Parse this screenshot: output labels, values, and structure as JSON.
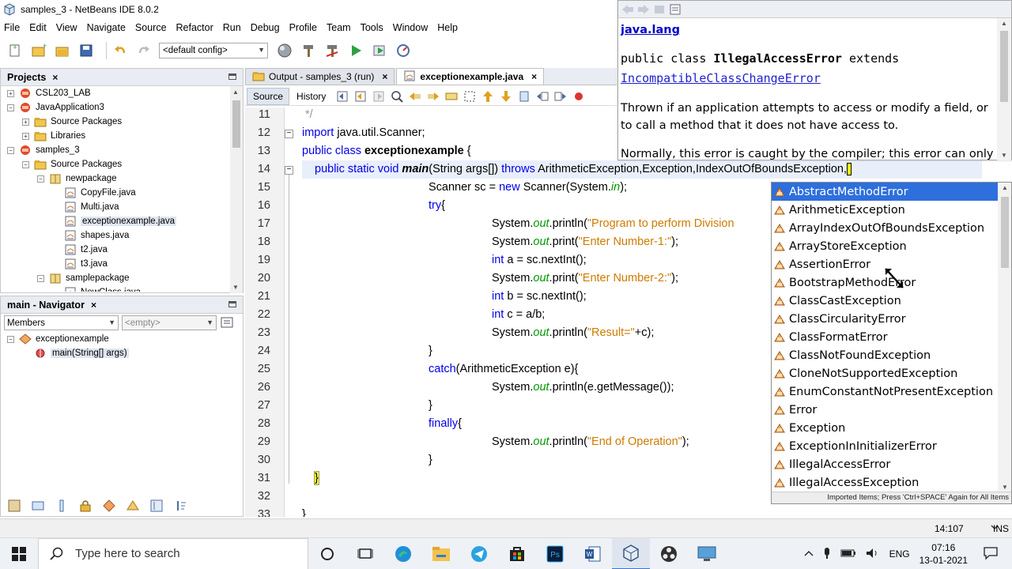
{
  "window": {
    "title": "samples_3 - NetBeans IDE 8.0.2"
  },
  "menu": [
    "File",
    "Edit",
    "View",
    "Navigate",
    "Source",
    "Refactor",
    "Run",
    "Debug",
    "Profile",
    "Team",
    "Tools",
    "Window",
    "Help"
  ],
  "toolbar": {
    "config": "<default config>"
  },
  "projects": {
    "title": "Projects",
    "tree": [
      {
        "label": "CSL203_LAB",
        "depth": 0,
        "expander": "+",
        "icon": "project-icon"
      },
      {
        "label": "JavaApplication3",
        "depth": 0,
        "expander": "−",
        "icon": "project-icon"
      },
      {
        "label": "Source Packages",
        "depth": 1,
        "expander": "+",
        "icon": "folder-icon"
      },
      {
        "label": "Libraries",
        "depth": 1,
        "expander": "+",
        "icon": "folder-icon"
      },
      {
        "label": "samples_3",
        "depth": 0,
        "expander": "−",
        "icon": "project-icon"
      },
      {
        "label": "Source Packages",
        "depth": 1,
        "expander": "−",
        "icon": "folder-icon"
      },
      {
        "label": "newpackage",
        "depth": 2,
        "expander": "−",
        "icon": "package-icon"
      },
      {
        "label": "CopyFile.java",
        "depth": 3,
        "expander": "",
        "icon": "java-file-icon"
      },
      {
        "label": "Multi.java",
        "depth": 3,
        "expander": "",
        "icon": "java-file-icon"
      },
      {
        "label": "exceptionexample.java",
        "depth": 3,
        "expander": "",
        "icon": "java-file-icon",
        "selected": true
      },
      {
        "label": "shapes.java",
        "depth": 3,
        "expander": "",
        "icon": "java-file-icon"
      },
      {
        "label": "t2.java",
        "depth": 3,
        "expander": "",
        "icon": "java-file-icon"
      },
      {
        "label": "t3.java",
        "depth": 3,
        "expander": "",
        "icon": "java-file-icon"
      },
      {
        "label": "samplepackage",
        "depth": 2,
        "expander": "−",
        "icon": "package-icon"
      },
      {
        "label": "NewClass.java",
        "depth": 3,
        "expander": "",
        "icon": "java-file-icon"
      }
    ]
  },
  "navigator": {
    "title": "main - Navigator",
    "filter": "Members",
    "filter2": "<empty>",
    "tree": [
      {
        "label": "exceptionexample",
        "depth": 0,
        "expander": "−",
        "icon": "class-icon"
      },
      {
        "label": "main(String[] args)",
        "depth": 1,
        "expander": "",
        "icon": "method-icon",
        "selected": true
      }
    ]
  },
  "editor": {
    "tabs": [
      {
        "label": "Output - samples_3 (run)",
        "active": false
      },
      {
        "label": "exceptionexample.java",
        "active": true
      }
    ],
    "source_tab": "Source",
    "history_tab": "History",
    "lines": [
      {
        "n": "11",
        "indent": 0,
        "segs": [
          {
            "t": " */",
            "c": "cmt"
          }
        ]
      },
      {
        "n": "12",
        "indent": 0,
        "segs": [
          {
            "t": "import",
            "c": "kw"
          },
          {
            "t": " java.util.Scanner;",
            "c": ""
          }
        ]
      },
      {
        "n": "13",
        "indent": 0,
        "segs": [
          {
            "t": "public class",
            "c": "kw"
          },
          {
            "t": " ",
            "c": ""
          },
          {
            "t": "exceptionexample",
            "c": "bold"
          },
          {
            "t": " {",
            "c": ""
          }
        ]
      },
      {
        "n": "14",
        "indent": 1,
        "current": true,
        "segs": [
          {
            "t": "public static void",
            "c": "kw"
          },
          {
            "t": " ",
            "c": ""
          },
          {
            "t": "main",
            "c": "bold it-b"
          },
          {
            "t": "(String args[]) ",
            "c": ""
          },
          {
            "t": "throws",
            "c": "kw"
          },
          {
            "t": " ArithmeticException,Exception,IndexOutOfBoundsException,",
            "c": ""
          }
        ]
      },
      {
        "n": "15",
        "indent": 2,
        "segs": [
          {
            "t": "Scanner sc = ",
            "c": ""
          },
          {
            "t": "new",
            "c": "kw"
          },
          {
            "t": " Scanner(System.",
            "c": ""
          },
          {
            "t": "in",
            "c": "it"
          },
          {
            "t": ");",
            "c": ""
          }
        ]
      },
      {
        "n": "16",
        "indent": 2,
        "segs": [
          {
            "t": "try",
            "c": "kw"
          },
          {
            "t": "{",
            "c": ""
          }
        ]
      },
      {
        "n": "17",
        "indent": 3,
        "segs": [
          {
            "t": "System.",
            "c": ""
          },
          {
            "t": "out",
            "c": "it"
          },
          {
            "t": ".println(",
            "c": ""
          },
          {
            "t": "\"Program to perform Division",
            "c": "str"
          }
        ]
      },
      {
        "n": "18",
        "indent": 3,
        "segs": [
          {
            "t": "System.",
            "c": ""
          },
          {
            "t": "out",
            "c": "it"
          },
          {
            "t": ".print(",
            "c": ""
          },
          {
            "t": "\"Enter Number-1:\"",
            "c": "str"
          },
          {
            "t": ");",
            "c": ""
          }
        ]
      },
      {
        "n": "19",
        "indent": 3,
        "segs": [
          {
            "t": "int",
            "c": "kw"
          },
          {
            "t": " a = sc.nextInt();",
            "c": ""
          }
        ]
      },
      {
        "n": "20",
        "indent": 3,
        "segs": [
          {
            "t": "System.",
            "c": ""
          },
          {
            "t": "out",
            "c": "it"
          },
          {
            "t": ".print(",
            "c": ""
          },
          {
            "t": "\"Enter Number-2:\"",
            "c": "str"
          },
          {
            "t": ");",
            "c": ""
          }
        ]
      },
      {
        "n": "21",
        "indent": 3,
        "segs": [
          {
            "t": "int",
            "c": "kw"
          },
          {
            "t": " b = sc.nextInt();",
            "c": ""
          }
        ]
      },
      {
        "n": "22",
        "indent": 3,
        "segs": [
          {
            "t": "int",
            "c": "kw"
          },
          {
            "t": " c = a/b;",
            "c": ""
          }
        ]
      },
      {
        "n": "23",
        "indent": 3,
        "segs": [
          {
            "t": "System.",
            "c": ""
          },
          {
            "t": "out",
            "c": "it"
          },
          {
            "t": ".println(",
            "c": ""
          },
          {
            "t": "\"Result=\"",
            "c": "str"
          },
          {
            "t": "+c);",
            "c": ""
          }
        ]
      },
      {
        "n": "24",
        "indent": 2,
        "segs": [
          {
            "t": "}",
            "c": ""
          }
        ]
      },
      {
        "n": "25",
        "indent": 2,
        "segs": [
          {
            "t": "catch",
            "c": "kw"
          },
          {
            "t": "(ArithmeticException e){",
            "c": ""
          }
        ]
      },
      {
        "n": "26",
        "indent": 3,
        "segs": [
          {
            "t": "System.",
            "c": ""
          },
          {
            "t": "out",
            "c": "it"
          },
          {
            "t": ".println(e.getMessage());",
            "c": ""
          }
        ]
      },
      {
        "n": "27",
        "indent": 2,
        "segs": [
          {
            "t": "}",
            "c": ""
          }
        ]
      },
      {
        "n": "28",
        "indent": 2,
        "segs": [
          {
            "t": "finally",
            "c": "kw"
          },
          {
            "t": "{",
            "c": ""
          }
        ]
      },
      {
        "n": "29",
        "indent": 3,
        "segs": [
          {
            "t": "System.",
            "c": ""
          },
          {
            "t": "out",
            "c": "it"
          },
          {
            "t": ".println(",
            "c": ""
          },
          {
            "t": "\"End of Operation\"",
            "c": "str"
          },
          {
            "t": ");",
            "c": ""
          }
        ]
      },
      {
        "n": "30",
        "indent": 2,
        "segs": [
          {
            "t": "}",
            "c": ""
          }
        ]
      },
      {
        "n": "31",
        "indent": 1,
        "segs": [
          {
            "t": "}",
            "c": "brace"
          }
        ]
      },
      {
        "n": "32",
        "indent": 0,
        "segs": []
      },
      {
        "n": "33",
        "indent": 0,
        "segs": [
          {
            "t": "}",
            "c": ""
          }
        ]
      }
    ]
  },
  "javadoc": {
    "package": "java.lang",
    "sig_prefix": "public class ",
    "sig_class": "IllegalAccessError",
    "sig_extends": " extends",
    "sig_parent": "IncompatibleClassChangeError",
    "desc1": "Thrown if an application attempts to access or modify a field, or to call a method that it does not have access to.",
    "desc2": "Normally, this error is caught by the compiler; this error can only"
  },
  "completion": {
    "items": [
      "AbstractMethodError",
      "ArithmeticException",
      "ArrayIndexOutOfBoundsException",
      "ArrayStoreException",
      "AssertionError",
      "BootstrapMethodError",
      "ClassCastException",
      "ClassCircularityError",
      "ClassFormatError",
      "ClassNotFoundException",
      "CloneNotSupportedException",
      "EnumConstantNotPresentException",
      "Error",
      "Exception",
      "ExceptionInInitializerError",
      "IllegalAccessError",
      "IllegalAccessException"
    ],
    "selected_index": 0,
    "footer": "Imported Items; Press 'Ctrl+SPACE' Again for All Items"
  },
  "status": {
    "position": "14:107",
    "mode": "INS"
  },
  "taskbar": {
    "search_placeholder": "Type here to search",
    "lang": "ENG",
    "time": "07:16",
    "date": "13-01-2021"
  },
  "colors": {
    "accent": "#2e6fdd",
    "keyword": "#0000e6",
    "string": "#ce7b00"
  }
}
